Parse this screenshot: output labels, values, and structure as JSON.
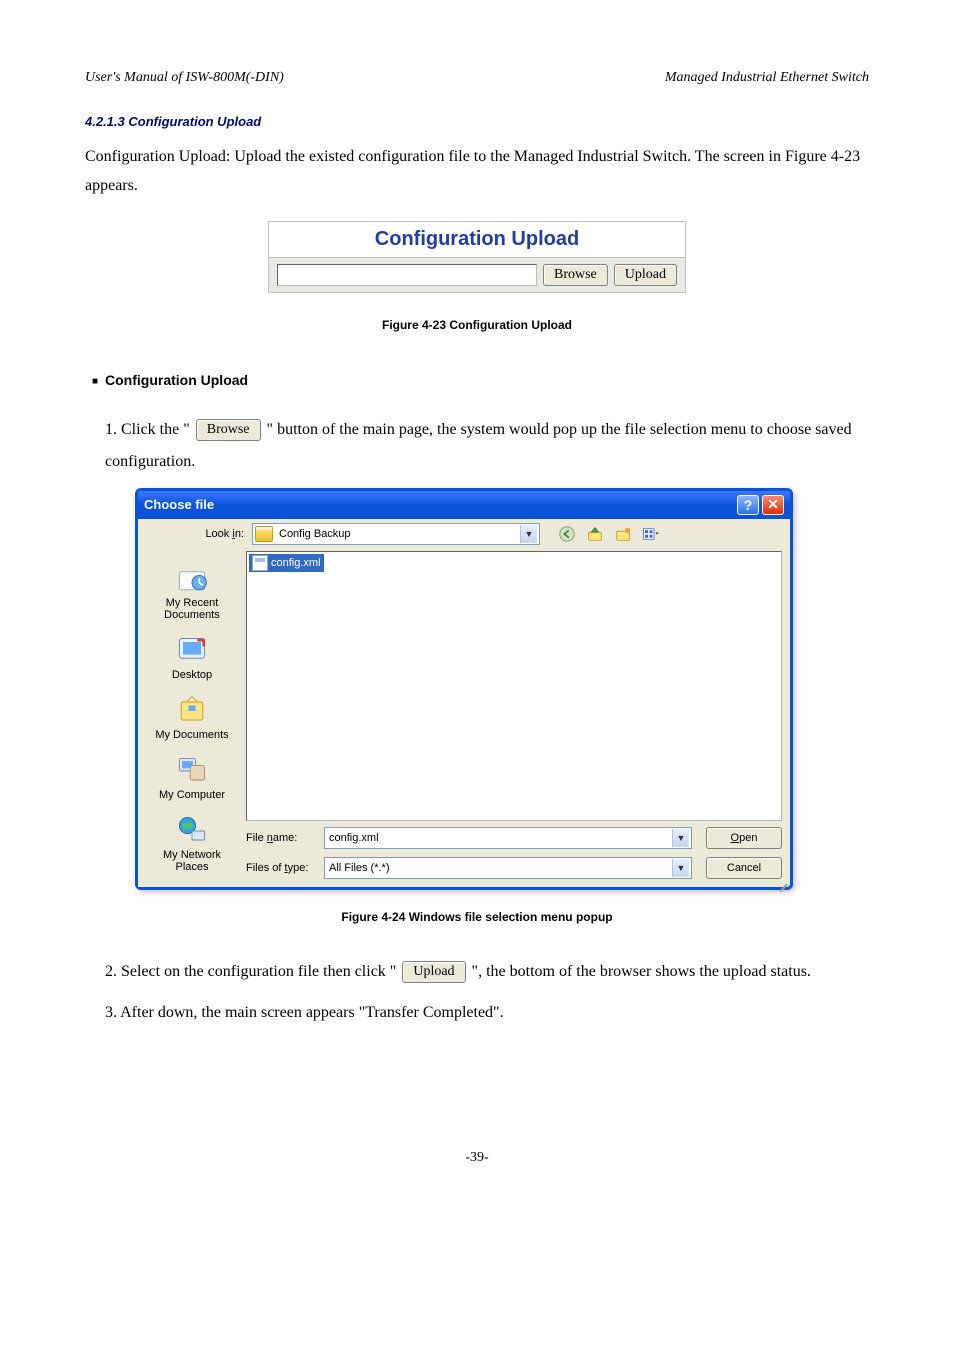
{
  "header": {
    "left": "User's Manual of ISW-800M(-DIN)",
    "right": "Managed Industrial Ethernet Switch"
  },
  "section_title": "4.2.1.3 Configuration Upload",
  "intro": "Configuration Upload: Upload the existed configuration file to the Managed Industrial Switch. The screen in Figure 4-23 appears.",
  "figure23_caption": "Figure 4-23 Configuration Upload",
  "cfg_panel": {
    "title": "Configuration Upload",
    "browse": "Browse",
    "upload": "Upload"
  },
  "upload_bullet_title": "Configuration Upload",
  "steps": {
    "s1_pre": "1. Click the \"",
    "s1_btn": "Browse",
    "s1_post": " \" button of the main page, the system would pop up the file selection menu to choose saved configuration.",
    "s2": "2. Select on the configuration file then click \"",
    "s2_btn": "Upload",
    "s2_post": "\", the bottom of the browser shows the upload status.",
    "s3": "3. After down, the main screen appears \"Transfer Completed\"."
  },
  "figure24_caption": "Figure 4-24 Windows file selection menu popup",
  "dialog": {
    "title": "Choose file",
    "lookin_label": "Look in:",
    "lookin_value": "Config Backup",
    "file_selected": "config.xml",
    "places": [
      "My Recent\nDocuments",
      "Desktop",
      "My Documents",
      "My Computer",
      "My Network\nPlaces"
    ],
    "filename_label": "File name:",
    "filename_value": "config.xml",
    "filetype_label": "Files of type:",
    "filetype_value": "All Files (*.*)",
    "open": "Open",
    "cancel": "Cancel"
  },
  "footer": "-39-"
}
